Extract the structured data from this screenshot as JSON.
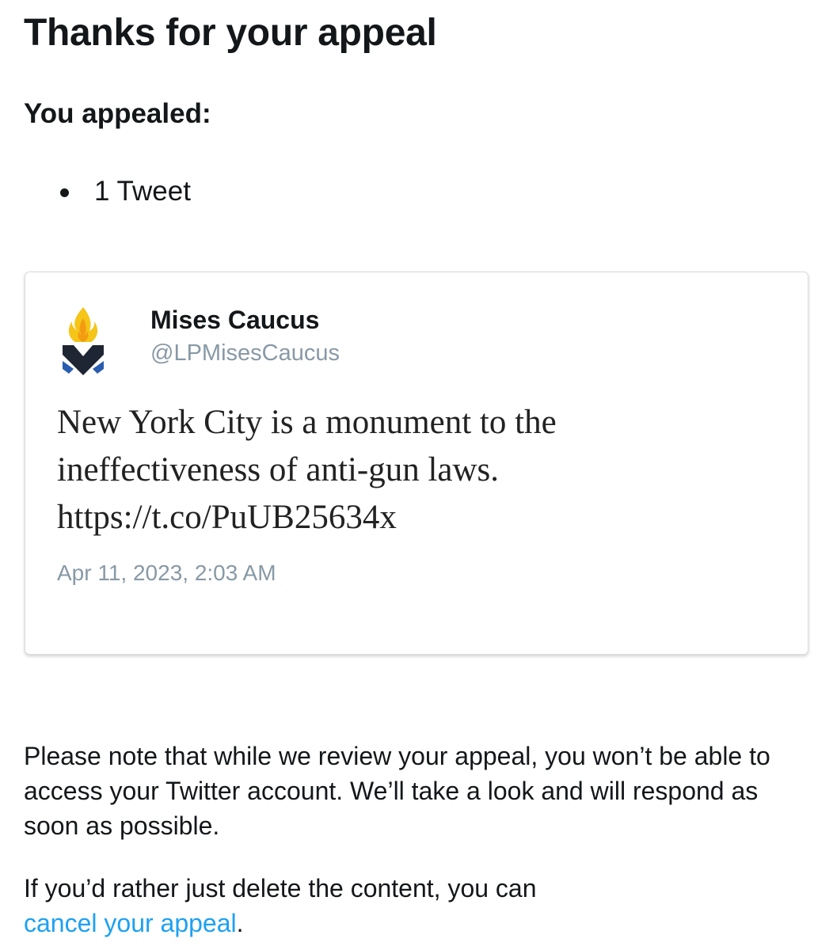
{
  "page": {
    "title": "Thanks for your appeal",
    "appealed_heading": "You appealed:",
    "appealed_items": [
      "1 Tweet"
    ]
  },
  "tweet": {
    "author_name": "Mises Caucus",
    "author_handle": "@LPMisesCaucus",
    "text_lines": [
      "New York City is a monument to the",
      "ineffectiveness of anti-gun laws.",
      "https://t.co/PuUB25634x"
    ],
    "date": "Apr 11, 2023, 2:03 AM",
    "avatar_icon": "mises-caucus-logo-icon"
  },
  "notice": {
    "review_text": "Please note that while we review your appeal, you won’t be able to access your Twitter account. We’ll take a look and will respond as soon as possible.",
    "delete_prefix": "If you’d rather just delete the content, you can",
    "cancel_link_label": "cancel your appeal",
    "delete_suffix": "."
  },
  "colors": {
    "text": "#14171a",
    "secondary_text": "#8899a6",
    "link": "#1da1f2",
    "flame_yellow": "#f5c518",
    "flame_orange": "#f39c12",
    "logo_dark": "#1f2633",
    "logo_blue": "#2a5db0"
  }
}
